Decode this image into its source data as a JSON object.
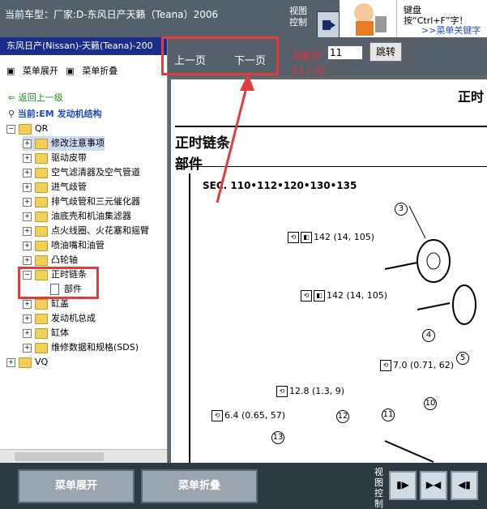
{
  "topbar": {
    "car_label": "当前车型：厂家:D-东风日产天籁（Teana）2006",
    "view_ctl": "视图控制",
    "help_text": "键盘按“Ctrl+F”字！",
    "help_link": ">>菜单关键字"
  },
  "sidebar": {
    "title": "东风日产(Nissan)-天籁(Teana)-200",
    "expand_label": "菜单展开",
    "collapse_label": "菜单折叠",
    "back_label": "返回上一级",
    "current_label": "当前:EM 发动机结构",
    "tree": {
      "qr": "QR",
      "items": [
        "修改注意事项",
        "驱动皮带",
        "空气滤清器及空气管道",
        "进气歧管",
        "排气歧管和三元催化器",
        "油底壳和机油集滤器",
        "点火线圈、火花塞和摇臂",
        "喷油嘴和油管",
        "凸轮轴",
        "正时链条"
      ],
      "child": "部件",
      "items2": [
        "缸盖",
        "发动机总成",
        "缸体",
        "维修数据和规格(SDS)"
      ],
      "vq": "VQ"
    }
  },
  "nav": {
    "prev": "上一页",
    "next": "下一页",
    "current_label": "当前为",
    "current_value": "11",
    "jump": "跳转",
    "page_count": "11 / 32"
  },
  "doc": {
    "corner_title": "正时",
    "h1": "正时链条",
    "h2": "部件",
    "sec": "SEC. 110•112•120•130•135",
    "torques": [
      "142 (14, 105)",
      "142 (14, 105)",
      "7.0 (0.71, 62)",
      "12.8 (1.3, 9)",
      "6.4 (0.65, 57)"
    ],
    "part_numbers": [
      "3",
      "4",
      "5",
      "10",
      "11",
      "12",
      "13"
    ]
  },
  "bottom": {
    "expand": "菜单展开",
    "collapse": "菜单折叠",
    "view_ctl": "视图控制"
  }
}
